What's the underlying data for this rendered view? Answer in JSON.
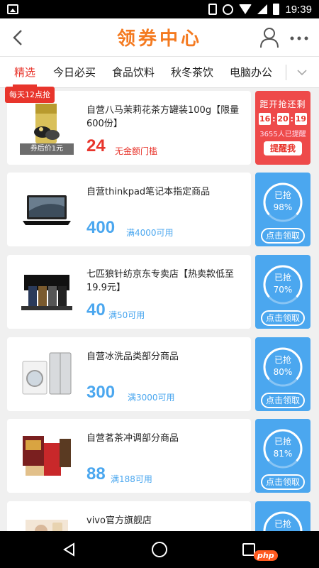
{
  "status_bar": {
    "time": "19:39"
  },
  "header": {
    "title": "领券中心"
  },
  "tabs": [
    {
      "label": "精选",
      "active": true
    },
    {
      "label": "今日必买",
      "active": false
    },
    {
      "label": "食品饮料",
      "active": false
    },
    {
      "label": "秋冬茶饮",
      "active": false
    },
    {
      "label": "电脑办公",
      "active": false
    }
  ],
  "featured": {
    "badge": "每天12点抢",
    "thumb_tag": "券后价1元",
    "name": "自营八马茉莉花茶方罐装100g【限量600份】",
    "amount": "24",
    "condition": "无金额门槛",
    "soon_label": "距开抢还剩",
    "timer": [
      "16",
      "20",
      "19"
    ],
    "remind_count": "3655人已提醒",
    "remind_button": "提醒我"
  },
  "coupons": [
    {
      "name": "自营thinkpad笔记本指定商品",
      "amount": "400",
      "condition": "满4000可用",
      "grabbed_label": "已抢",
      "grabbed": "98%",
      "button": "点击领取"
    },
    {
      "name": "七匹狼针纺京东专卖店【热卖款低至19.9元】",
      "amount": "40",
      "condition": "满50可用",
      "grabbed_label": "已抢",
      "grabbed": "70%",
      "button": "点击领取"
    },
    {
      "name": "自营冰洗品类部分商品",
      "amount": "300",
      "condition": "满3000可用",
      "grabbed_label": "已抢",
      "grabbed": "80%",
      "button": "点击领取"
    },
    {
      "name": "自营茗茶冲调部分商品",
      "amount": "88",
      "condition": "满188可用",
      "grabbed_label": "已抢",
      "grabbed": "81%",
      "button": "点击领取"
    },
    {
      "name": "vivo官方旗舰店",
      "grabbed_label": "已抢"
    }
  ],
  "watermark": "php",
  "colors": {
    "accent_orange": "#f47a20",
    "accent_red": "#e8352c",
    "coupon_blue": "#4ba7ef",
    "remind_red": "#ee4a4a"
  }
}
